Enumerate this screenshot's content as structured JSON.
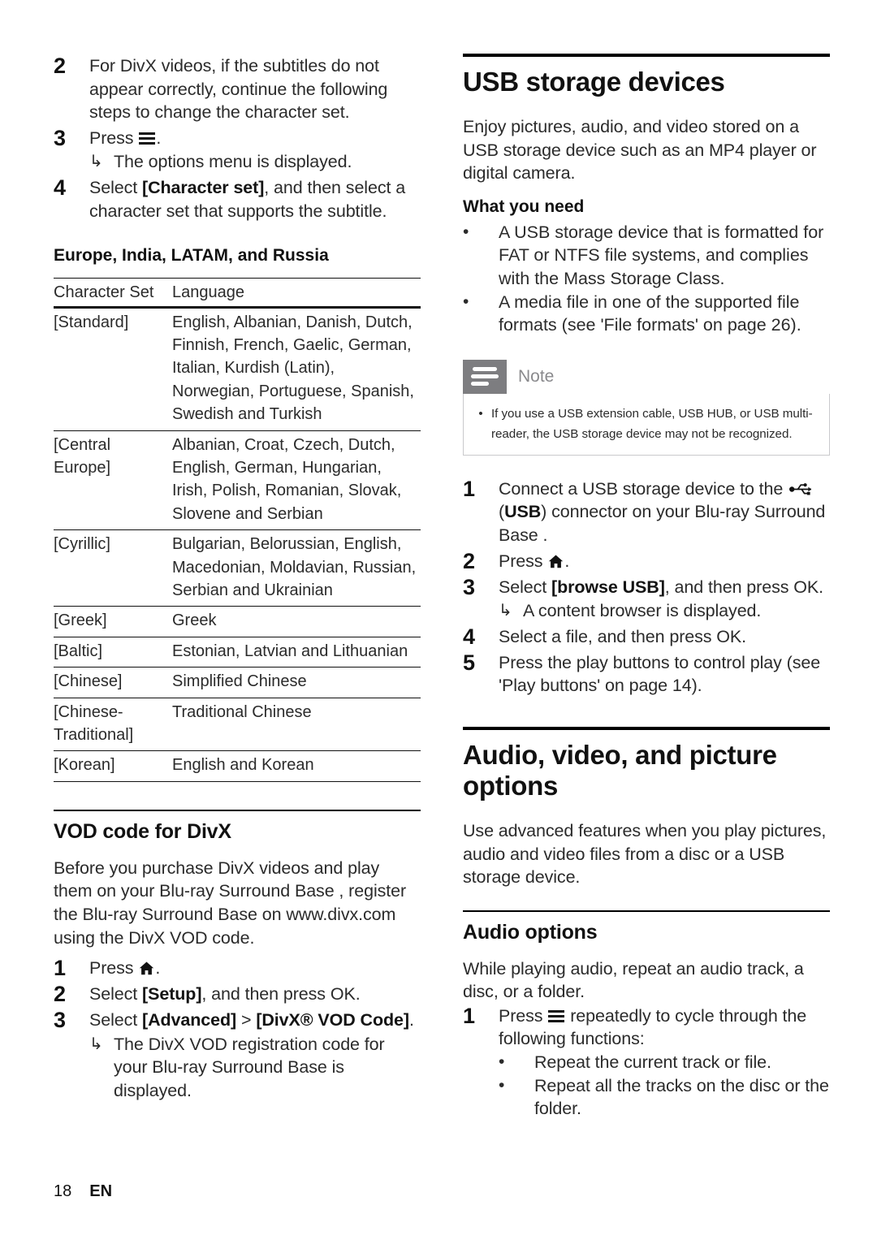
{
  "footer": {
    "page_number": "18",
    "language": "EN"
  },
  "left_column": {
    "steps_top": [
      {
        "num": "2",
        "text": "For DivX videos, if the subtitles do not appear correctly, continue the following steps to change the character set."
      },
      {
        "num": "3",
        "text_before": "Press",
        "icon": "menu-icon",
        "text_after": ".",
        "sub": "The options menu is displayed."
      },
      {
        "num": "4",
        "text_before": "Select ",
        "bold": "[Character set]",
        "text_after": ", and then select a character set that supports the subtitle."
      }
    ],
    "table": {
      "title": "Europe, India, LATAM, and Russia",
      "headers": [
        "Character Set",
        "Language"
      ],
      "rows": [
        {
          "set": "[Standard]",
          "lang": "English, Albanian, Danish, Dutch, Finnish, French, Gaelic, German, Italian, Kurdish (Latin), Norwegian, Portuguese, Spanish, Swedish and Turkish"
        },
        {
          "set": "[Central Europe]",
          "lang": "Albanian, Croat, Czech, Dutch, English, German, Hungarian, Irish, Polish, Romanian, Slovak, Slovene and Serbian"
        },
        {
          "set": "[Cyrillic]",
          "lang": "Bulgarian, Belorussian, English, Macedonian, Moldavian, Russian, Serbian and Ukrainian"
        },
        {
          "set": "[Greek]",
          "lang": "Greek"
        },
        {
          "set": "[Baltic]",
          "lang": "Estonian, Latvian and Lithuanian"
        },
        {
          "set": "[Chinese]",
          "lang": "Simplified Chinese"
        },
        {
          "set": "[Chinese-Traditional]",
          "lang": "Traditional Chinese"
        },
        {
          "set": "[Korean]",
          "lang": "English and Korean"
        }
      ]
    },
    "vod": {
      "heading": "VOD code for DivX",
      "intro": "Before you purchase DivX videos and play them on your Blu-ray Surround Base , register the Blu-ray Surround Base  on www.divx.com using the DivX VOD code.",
      "steps": [
        {
          "num": "1",
          "text_before": "Press",
          "icon": "home-icon",
          "text_after": "."
        },
        {
          "num": "2",
          "text_before": "Select ",
          "bold": "[Setup]",
          "text_after": ", and then press OK."
        },
        {
          "num": "3",
          "text_before": "Select ",
          "bold": "[Advanced]",
          "mid": " > ",
          "bold2": "[DivX® VOD Code]",
          "text_after": ".",
          "sub": "The DivX VOD registration code for your Blu-ray Surround Base  is displayed."
        }
      ]
    }
  },
  "right_column": {
    "usb": {
      "heading": "USB storage devices",
      "intro": "Enjoy pictures, audio, and video stored on a USB storage device such as an MP4 player or digital camera.",
      "what_you_need_heading": "What you need",
      "what_you_need": [
        "A USB storage device that is formatted for FAT or NTFS file systems, and complies with the Mass Storage Class.",
        "A media file in one of the supported file formats (see 'File formats' on page 26)."
      ],
      "note": {
        "label": "Note",
        "icon": "note-icon",
        "items": [
          "If you use a USB extension cable, USB HUB, or USB multi-reader, the USB storage device may not be recognized."
        ]
      },
      "steps": [
        {
          "num": "1",
          "text_before": "Connect a USB storage device to the ",
          "icon": "usb-icon",
          "text_mid": " (",
          "bold": "USB",
          "text_after": ") connector on your Blu-ray Surround Base ."
        },
        {
          "num": "2",
          "text_before": "Press",
          "icon": "home-icon",
          "text_after": "."
        },
        {
          "num": "3",
          "text_before": "Select ",
          "bold": "[browse USB]",
          "text_after": ", and then press OK.",
          "sub": "A content browser is displayed."
        },
        {
          "num": "4",
          "text_before": "Select a file, and then press OK."
        },
        {
          "num": "5",
          "text_before": "Press the play buttons to control play (see 'Play buttons' on page 14)."
        }
      ]
    },
    "avp": {
      "heading": "Audio, video, and picture options",
      "intro": "Use advanced features when you play pictures, audio and video files from a disc or a USB storage device.",
      "audio_options": {
        "heading": "Audio options",
        "intro": "While playing audio, repeat an audio track, a disc, or a folder.",
        "step": {
          "num": "1",
          "text_before": "Press",
          "icon": "menu-icon",
          "text_after": " repeatedly to cycle through the following functions:"
        },
        "bullets": [
          "Repeat the current track or file.",
          "Repeat all the tracks on the disc or the folder."
        ]
      }
    }
  },
  "colors": {
    "note_icon_bg": "#7d7d80",
    "note_label": "#8a8a8d",
    "note_border": "#c9c9cc",
    "text": "#2b2b2b",
    "rule": "#000000"
  }
}
